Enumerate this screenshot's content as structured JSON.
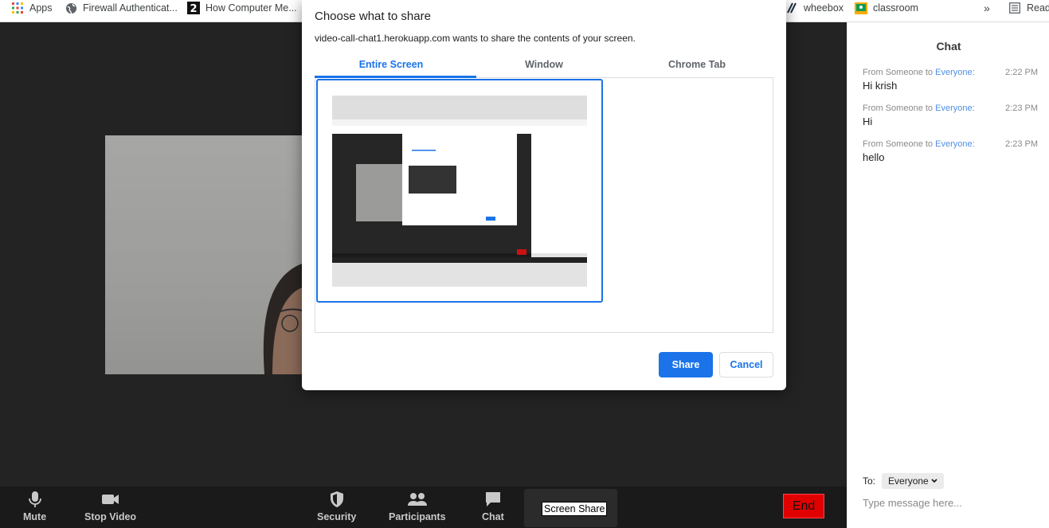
{
  "bookmarks": {
    "apps": "Apps",
    "firewall": "Firewall Authenticat...",
    "howcomputer": "How Computer Me...",
    "wheebox": "wheebox",
    "classroom": "classroom",
    "more": "»",
    "reading": "Read"
  },
  "dialog": {
    "title": "Choose what to share",
    "subtitle": "video-call-chat1.herokuapp.com wants to share the contents of your screen.",
    "tabs": [
      "Entire Screen",
      "Window",
      "Chrome Tab"
    ],
    "active_tab": "Entire Screen",
    "share_label": "Share",
    "cancel_label": "Cancel"
  },
  "chat": {
    "title": "Chat",
    "messages": [
      {
        "from": "From Someone to",
        "to": "Everyone:",
        "time": "2:22 PM",
        "text": "Hi krish"
      },
      {
        "from": "From Someone to",
        "to": "Everyone:",
        "time": "2:23 PM",
        "text": "Hi"
      },
      {
        "from": "From Someone to",
        "to": "Everyone:",
        "time": "2:23 PM",
        "text": "hello"
      }
    ],
    "to_label": "To:",
    "to_value": "Everyone",
    "input_placeholder": "Type message here..."
  },
  "toolbar": {
    "mute": "Mute",
    "stop_video": "Stop Video",
    "security": "Security",
    "participants": "Participants",
    "chat": "Chat",
    "screen_share": "Screen Share",
    "end": "End"
  },
  "colors": {
    "accent": "#1a73e8",
    "end": "#e00000",
    "link": "#4f8fe6"
  }
}
